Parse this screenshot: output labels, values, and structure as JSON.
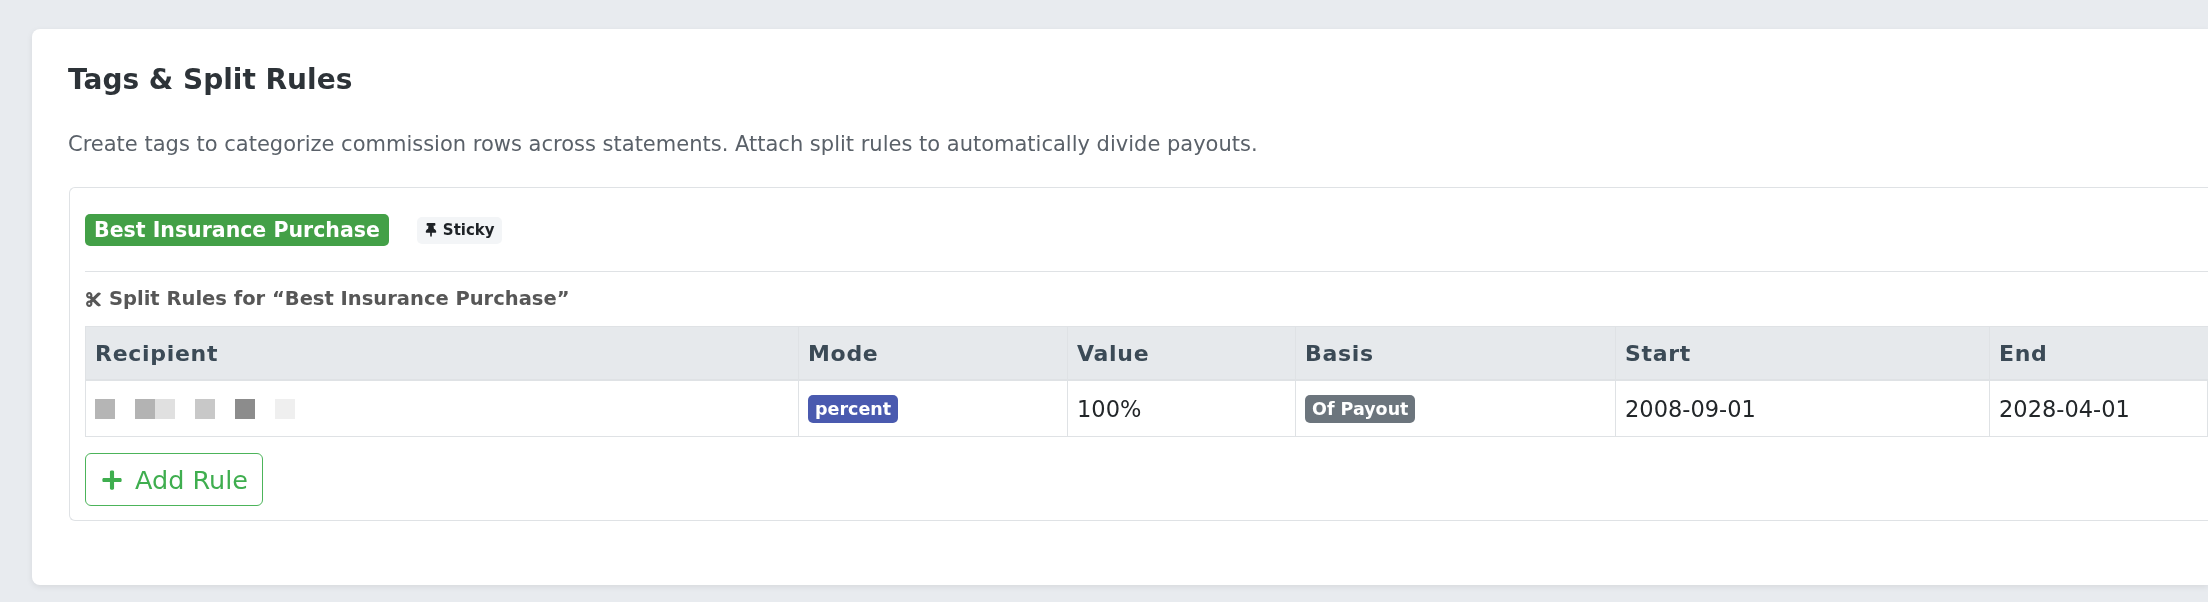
{
  "card": {
    "title": "Tags & Split Rules",
    "description": "Create tags to categorize commission rows across statements. Attach split rules to automatically divide payouts."
  },
  "tags": [
    {
      "label": "Best Insurance Purchase",
      "color": "#43a047",
      "sticky_label": "Sticky",
      "split_rules": {
        "heading": "Split Rules for “Best Insurance Purchase”",
        "columns": [
          "Recipient",
          "Mode",
          "Value",
          "Basis",
          "Start",
          "End"
        ],
        "rows": [
          {
            "cells": [
              {
                "kind": "redacted"
              },
              {
                "kind": "mode_badge",
                "text": "percent"
              },
              {
                "kind": "text",
                "text": "100%"
              },
              {
                "kind": "basis_badge",
                "text": "Of Payout"
              },
              {
                "kind": "text",
                "text": "2008-09-01"
              },
              {
                "kind": "text",
                "text": "2028-04-01"
              }
            ]
          }
        ],
        "add_button": "Add Rule"
      }
    }
  ]
}
